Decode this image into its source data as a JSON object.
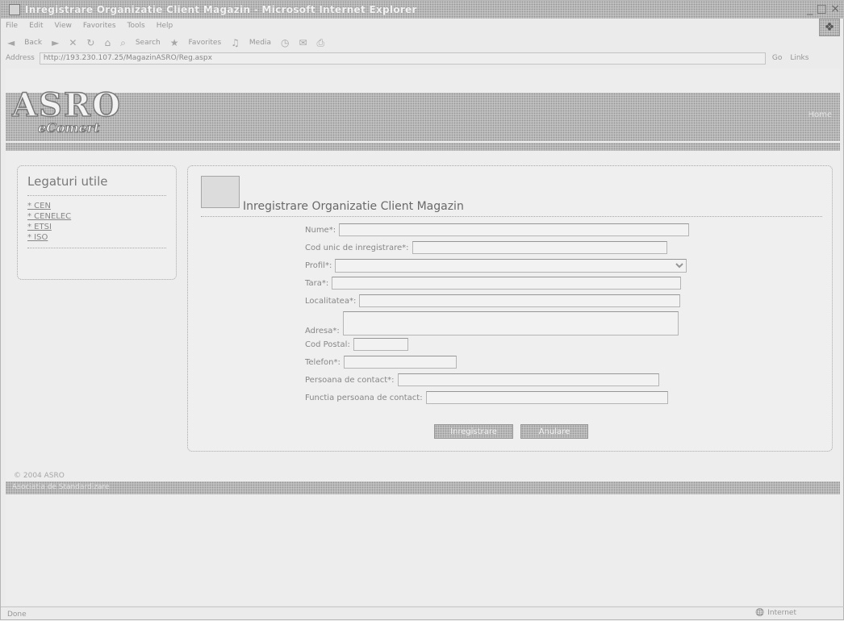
{
  "window": {
    "title": "Inregistrare Organizatie Client Magazin - Microsoft Internet Explorer",
    "controls": "_ □ ×"
  },
  "menubar": {
    "items": [
      "File",
      "Edit",
      "View",
      "Favorites",
      "Tools",
      "Help"
    ]
  },
  "toolbar": {
    "back": "Back",
    "search": "Search",
    "favorites": "Favorites",
    "media": "Media"
  },
  "addressbar": {
    "label": "Address",
    "url": "http://193.230.107.25/MagazinASRO/Reg.aspx",
    "go": "Go",
    "links": "Links"
  },
  "logo": {
    "mark": "ASRO",
    "sub": "eComert"
  },
  "banner": {
    "right_text": "Home"
  },
  "sidebar": {
    "title": "Legaturi utile",
    "links": [
      "* CEN",
      "* CENELEC",
      "* ETSI",
      "* ISO"
    ]
  },
  "form": {
    "title": "Inregistrare Organizatie Client Magazin",
    "fields": {
      "nume": "Nume*:",
      "cui": "Cod unic de inregistrare*:",
      "profil": "Profil*:",
      "tara": "Tara*:",
      "localitatea": "Localitatea*:",
      "adresa": "Adresa*:",
      "cod_postal": "Cod Postal:",
      "telefon": "Telefon*:",
      "persoana": "Persoana de contact*:",
      "functia": "Functia persoana de contact:"
    },
    "buttons": {
      "submit": "Inregistrare",
      "cancel": "Anulare"
    }
  },
  "footer": {
    "text": "© 2004 ASRO",
    "bar_label": "Asociatia de Standardizare"
  },
  "statusbar": {
    "left": "Done",
    "zone": "Internet"
  }
}
